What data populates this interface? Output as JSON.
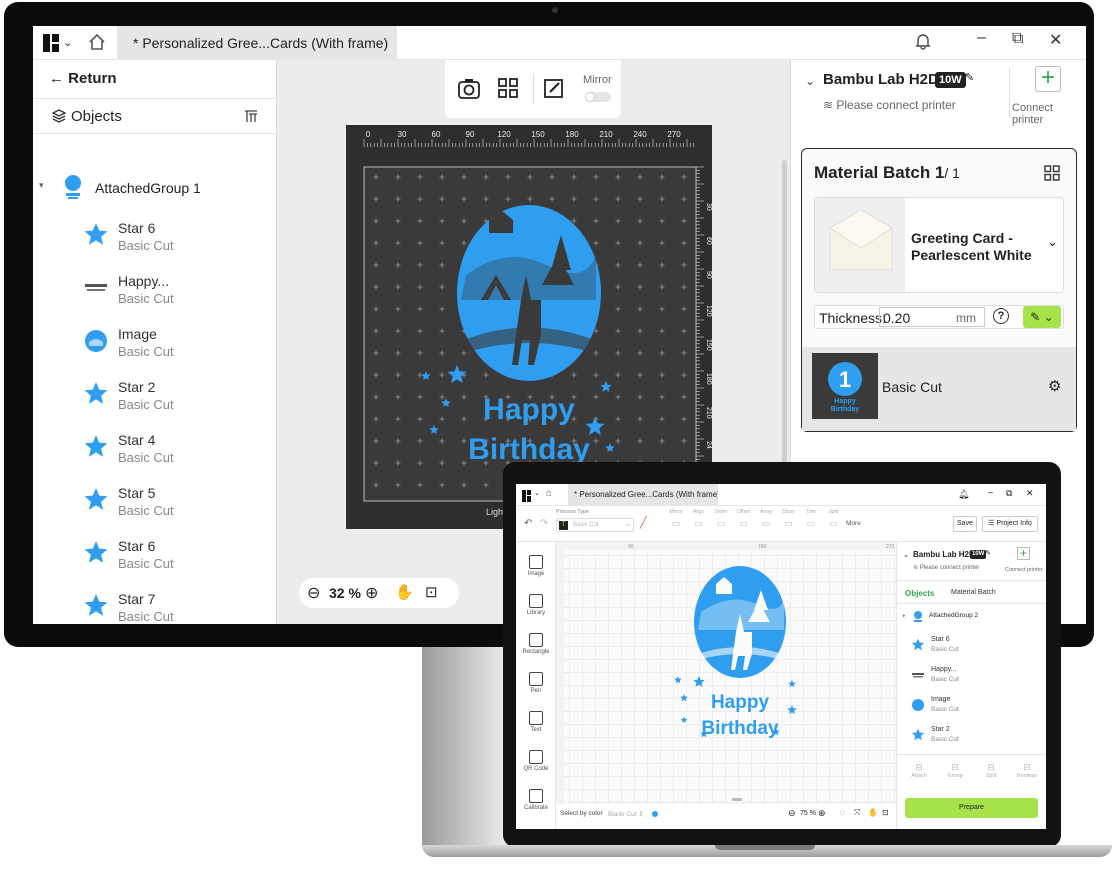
{
  "colors": {
    "accent": "#2f9ef0",
    "prepare_green": "#a6e34a",
    "mat": "#2e2e2e",
    "badge_bg": "#222222"
  },
  "monitor": {
    "tab_title": "* Personalized Gree...Cards (With frame)",
    "left": {
      "return_label": "Return",
      "objects_label": "Objects",
      "group_name": "AttachedGroup 1",
      "items": [
        {
          "name": "Star 6",
          "sub": "Basic Cut",
          "icon": "star-icon"
        },
        {
          "name": "Happy...",
          "sub": "Basic Cut",
          "icon": "text-thumb"
        },
        {
          "name": "Image",
          "sub": "Basic Cut",
          "icon": "image-thumb"
        },
        {
          "name": "Star 2",
          "sub": "Basic Cut",
          "icon": "star-icon"
        },
        {
          "name": "Star 4",
          "sub": "Basic Cut",
          "icon": "star-icon"
        },
        {
          "name": "Star 5",
          "sub": "Basic Cut",
          "icon": "star-icon"
        },
        {
          "name": "Star 6",
          "sub": "Basic Cut",
          "icon": "star-icon"
        },
        {
          "name": "Star 7",
          "sub": "Basic Cut",
          "icon": "star-icon"
        }
      ]
    },
    "canvas": {
      "mirror_label": "Mirror",
      "ruler_top": [
        "0",
        "30",
        "60",
        "90",
        "120",
        "150",
        "180",
        "210",
        "240",
        "270"
      ],
      "ruler_side": [
        "30",
        "60",
        "90",
        "120",
        "150",
        "180",
        "210",
        "24"
      ],
      "art_text_1": "Happy",
      "art_text_2": "Birthday",
      "mat_label": "Ligh",
      "zoom": "32 %"
    },
    "right": {
      "printer_name": "Bambu Lab H2D",
      "printer_badge": "10W",
      "printer_status": "Please connect printer",
      "connect_label": "Connect printer",
      "batch_title": "Material Batch 1",
      "batch_count": "/ 1",
      "material_name": "Greeting Card - Pearlescent White",
      "thickness_label": "Thickness:",
      "thickness_value": "0.20",
      "thickness_unit": "mm",
      "batch_item_number": "1",
      "batch_item_label": "Basic Cut",
      "thumb_text_1": "Happy",
      "thumb_text_2": "Birthday"
    }
  },
  "laptop": {
    "tab_title": "* Personalized Gree...Cards (With frame)",
    "process_type_label": "Process Type",
    "process_value": "Basic Cut",
    "toolbar_groups": [
      "Mirror",
      "Align",
      "Order",
      "Offset",
      "Array",
      "Slicer",
      "Trim",
      "Split"
    ],
    "more_label": "More",
    "save_label": "Save",
    "project_info_label": "Project Info",
    "tools": [
      "Image",
      "Library",
      "Rectangle",
      "Pen",
      "Text",
      "QR Code",
      "Calibrate"
    ],
    "ruler": [
      "90",
      "180",
      "270"
    ],
    "art_text_1": "Happy",
    "art_text_2": "Birthday",
    "select_by_color_label": "Select by color",
    "select_by_color_value": "Blade Cut",
    "zoom": "75 %",
    "printer_name": "Bambu Lab H2D",
    "printer_badge": "10W",
    "printer_status": "Please connect printer",
    "connect_label": "Connect printer",
    "tab_objects": "Objects",
    "tab_material": "Material Batch",
    "group_name": "AttachedGroup 2",
    "items": [
      {
        "name": "Star 6",
        "sub": "Basic Cut"
      },
      {
        "name": "Happy...",
        "sub": "Basic Cut"
      },
      {
        "name": "Image",
        "sub": "Basic Cut"
      },
      {
        "name": "Star 2",
        "sub": "Basic Cut"
      }
    ],
    "bottom_actions": [
      "Attach",
      "Group",
      "Split",
      "Boolean"
    ],
    "prepare_label": "Prepare"
  }
}
